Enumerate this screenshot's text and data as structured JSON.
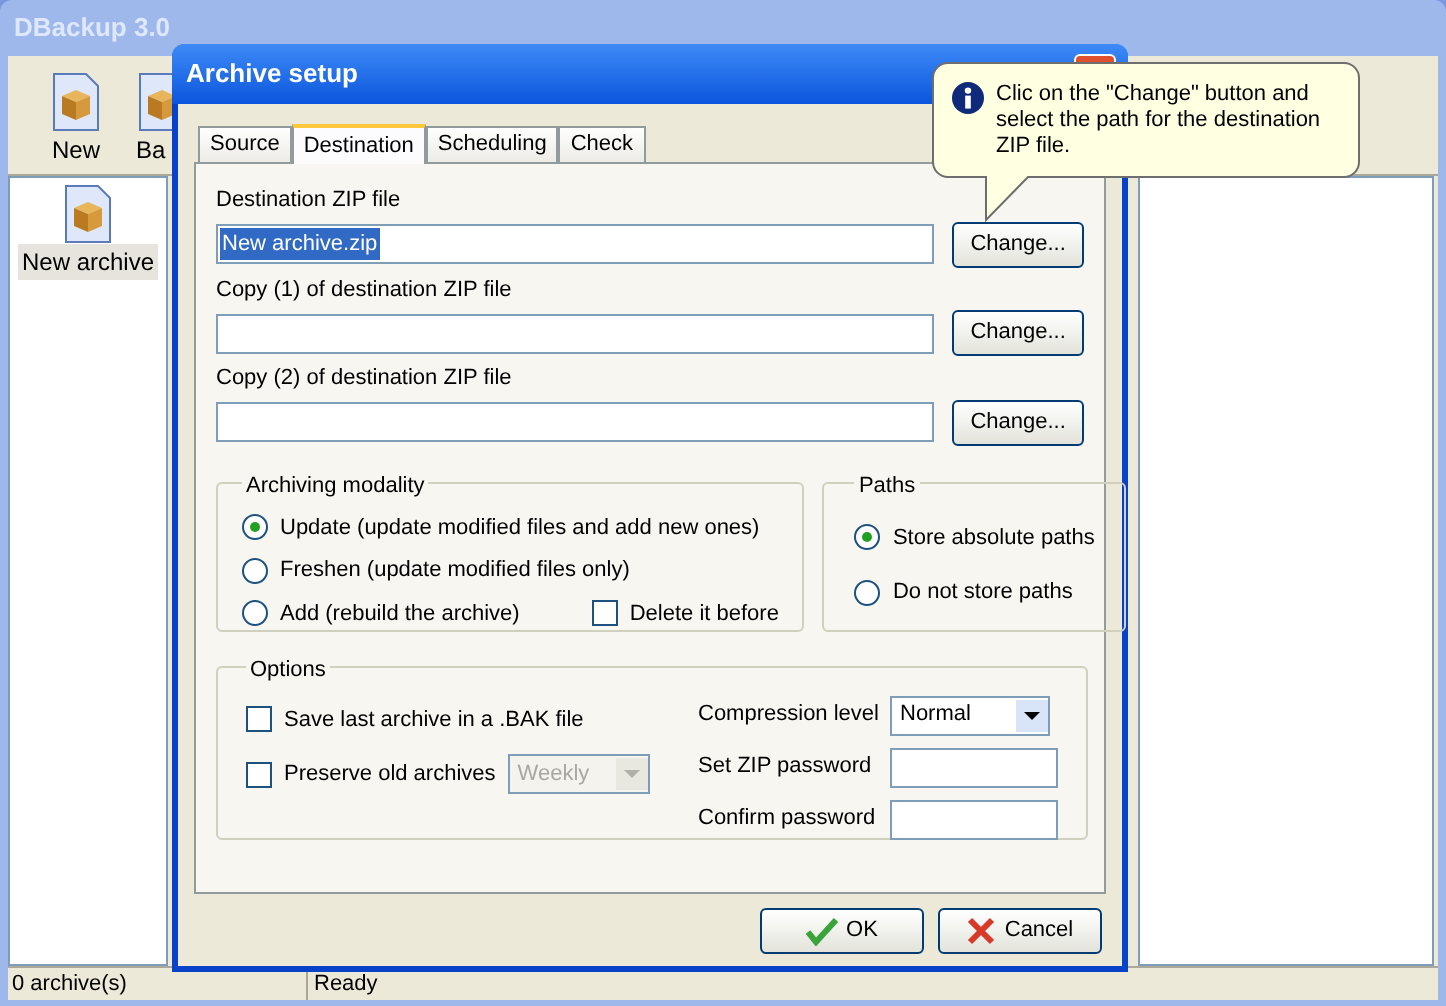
{
  "main_window": {
    "title": "DBackup 3.0",
    "toolbar": [
      {
        "label": "New"
      },
      {
        "label": "Ba"
      }
    ],
    "archives": [
      {
        "label": "New archive",
        "selected": true
      }
    ],
    "status_bar": [
      "0 archive(s)",
      "Ready"
    ]
  },
  "dialog": {
    "title": "Archive setup",
    "tabs": [
      {
        "label": "Source",
        "selected": false
      },
      {
        "label": "Destination",
        "selected": true
      },
      {
        "label": "Scheduling",
        "selected": false
      },
      {
        "label": "Check",
        "selected": false
      }
    ],
    "destination_fields": [
      {
        "label": "Destination ZIP file",
        "value": "New archive.zip",
        "value_selected": true,
        "button": "Change..."
      },
      {
        "label": "Copy (1) of destination ZIP file",
        "button": "Change..."
      },
      {
        "label": "Copy (2) of destination ZIP file",
        "button": "Change..."
      }
    ],
    "archiving_modality": {
      "title": "Archiving modality",
      "options": [
        {
          "label": "Update (update modified files and add new ones)",
          "selected": true
        },
        {
          "label": "Freshen (update modified files only)",
          "selected": false
        },
        {
          "label": "Add (rebuild the archive)",
          "selected": false
        }
      ],
      "delete_before": {
        "label": "Delete it before",
        "checked": false
      }
    },
    "paths": {
      "title": "Paths",
      "options": [
        {
          "label": "Store absolute paths",
          "selected": true
        },
        {
          "label": "Do not store paths",
          "selected": false
        }
      ]
    },
    "options": {
      "title": "Options",
      "save_bak": {
        "label": "Save last archive in a .BAK file",
        "checked": false
      },
      "preserve": {
        "label": "Preserve old archives",
        "checked": false,
        "value": "Weekly",
        "disabled": true
      },
      "compression": {
        "label": "Compression level",
        "value": "Normal"
      },
      "zip_password": {
        "label": "Set ZIP password"
      },
      "confirm_password": {
        "label": "Confirm password"
      }
    },
    "buttons": [
      {
        "label": "OK",
        "kind": "ok"
      },
      {
        "label": "Cancel",
        "kind": "cancel"
      }
    ]
  },
  "tooltip": {
    "text": "Clic on the \"Change\" button and select the path for the destination ZIP file."
  }
}
